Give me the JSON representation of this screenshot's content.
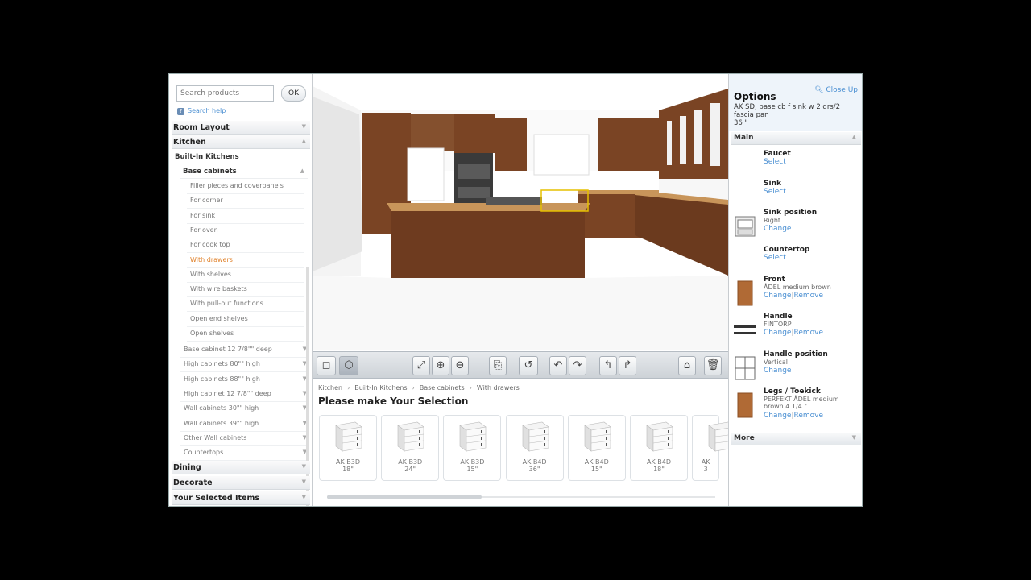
{
  "left": {
    "search_placeholder": "Search products",
    "ok": "OK",
    "search_help": "Search help",
    "room_layout": "Room Layout",
    "kitchen": "Kitchen",
    "built_in": "Built-In Kitchens",
    "base_cabinets": "Base cabinets",
    "leaves": [
      "Filler pieces and coverpanels",
      "For corner",
      "For sink",
      "For oven",
      "For cook top",
      "With drawers",
      "With shelves",
      "With wire baskets",
      "With pull-out functions",
      "Open end shelves",
      "Open shelves"
    ],
    "active_leaf": 5,
    "groups": [
      "Base cabinet 12 7/8\"\" deep",
      "High cabinets 80\"\" high",
      "High cabinets 88\"\" high",
      "High cabinet 12 7/8\"\" deep",
      "Wall cabinets 30\"\" high",
      "Wall cabinets 39\"\" high",
      "Other Wall cabinets",
      "Countertops"
    ],
    "dining": "Dining",
    "decorate": "Decorate",
    "selected_items": "Your Selected Items"
  },
  "toolbar": {
    "icons": [
      "2d-view-icon",
      "3d-view-icon",
      "zoom-fit-icon",
      "zoom-in-icon",
      "zoom-out-icon",
      "copy-icon",
      "undo-icon",
      "rotate-left-icon",
      "rotate-right-icon",
      "flip-left-icon",
      "flip-right-icon",
      "save-icon",
      "delete-icon"
    ],
    "glyphs": [
      "◻",
      "⬡",
      "⤢",
      "⊕",
      "⊖",
      "⎘",
      "↺",
      "↶",
      "↷",
      "↰",
      "↱",
      "⌂",
      "🗑"
    ]
  },
  "browser": {
    "crumbs": [
      "Kitchen",
      "Built-In Kitchens",
      "Base cabinets",
      "With drawers"
    ],
    "title": "Please make Your Selection",
    "products": [
      {
        "code": "AK B3D",
        "size": "18\""
      },
      {
        "code": "AK B3D",
        "size": "24\""
      },
      {
        "code": "AK B3D",
        "size": "15\""
      },
      {
        "code": "AK B4D",
        "size": "36\""
      },
      {
        "code": "AK B4D",
        "size": "15\""
      },
      {
        "code": "AK B4D",
        "size": "18\""
      },
      {
        "code": "AK",
        "size": "3"
      }
    ]
  },
  "right": {
    "title": "Options",
    "close_up": "Close Up",
    "desc": "AK SD, base cb f sink w 2 drs/2 fascia pan",
    "size": "36 \"",
    "main": "Main",
    "more": "More",
    "sep": "|",
    "options": [
      {
        "name": "Faucet",
        "value": "",
        "links": [
          "Select"
        ]
      },
      {
        "name": "Sink",
        "value": "",
        "links": [
          "Select"
        ]
      },
      {
        "name": "Sink position",
        "value": "Right",
        "links": [
          "Change"
        ]
      },
      {
        "name": "Countertop",
        "value": "",
        "links": [
          "Select"
        ]
      },
      {
        "name": "Front",
        "value": "ÅDEL medium brown",
        "links": [
          "Change",
          "Remove"
        ]
      },
      {
        "name": "Handle",
        "value": "FINTORP",
        "links": [
          "Change",
          "Remove"
        ]
      },
      {
        "name": "Handle position",
        "value": "Vertical",
        "links": [
          "Change"
        ]
      },
      {
        "name": "Legs / Toekick",
        "value": "PERFEKT ÅDEL medium brown 4 1/4 \"",
        "links": [
          "Change",
          "Remove"
        ]
      }
    ]
  },
  "colors": {
    "wood": "#7a4424",
    "accent": "#4a8fd2",
    "active": "#e0812a"
  }
}
